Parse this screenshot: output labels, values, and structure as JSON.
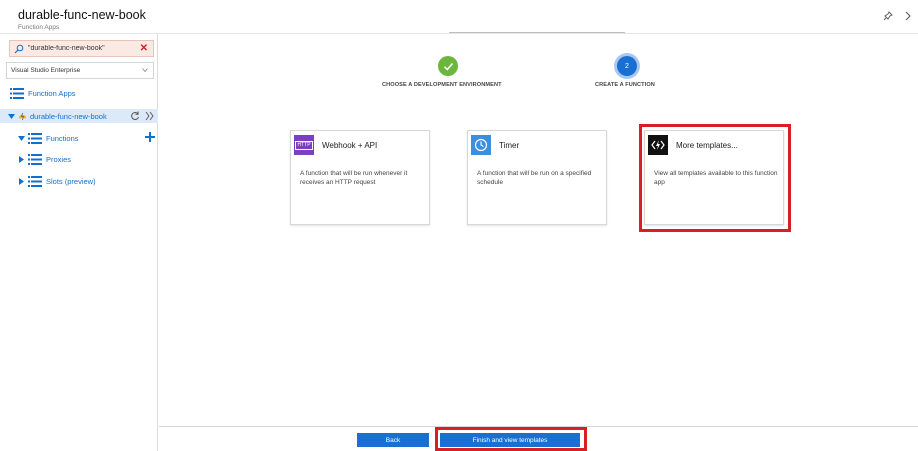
{
  "header": {
    "title": "durable-func-new-book",
    "subtitle": "Function Apps",
    "icons": [
      "pin-icon",
      "expand-icon"
    ]
  },
  "sidebar": {
    "search": {
      "value": "\"durable-func-new-book\"",
      "clear_icon": "close-icon"
    },
    "subscription": {
      "selected": "Visual Studio Enterprise"
    },
    "function_apps_label": "Function Apps",
    "app_name": "durable-func-new-book",
    "tree": {
      "functions_label": "Functions",
      "proxies_label": "Proxies",
      "slots_label": "Slots (preview)"
    }
  },
  "wizard": {
    "steps": [
      {
        "label": "CHOOSE A DEVELOPMENT ENVIRONMENT",
        "state": "done"
      },
      {
        "label": "CREATE A FUNCTION",
        "state": "active",
        "number": "2"
      }
    ]
  },
  "cards": [
    {
      "title": "Webhook + API",
      "icon": "http-icon",
      "icon_text": "HTTP",
      "description": "A function that will be run whenever it receives an HTTP request"
    },
    {
      "title": "Timer",
      "icon": "clock-icon",
      "description": "A function that will be run on a specified schedule"
    },
    {
      "title": "More templates...",
      "icon": "function-bolt-icon",
      "description": "View all templates available to this function app"
    }
  ],
  "footer": {
    "back_label": "Back",
    "finish_label": "Finish and view templates"
  },
  "colors": {
    "accent": "#1a6fd3",
    "success": "#6cb63d",
    "highlight": "#d91f26",
    "webhook_icon_bg": "#7b3fc4",
    "timer_icon_bg": "#3b8ee0",
    "more_icon_bg": "#111111"
  }
}
